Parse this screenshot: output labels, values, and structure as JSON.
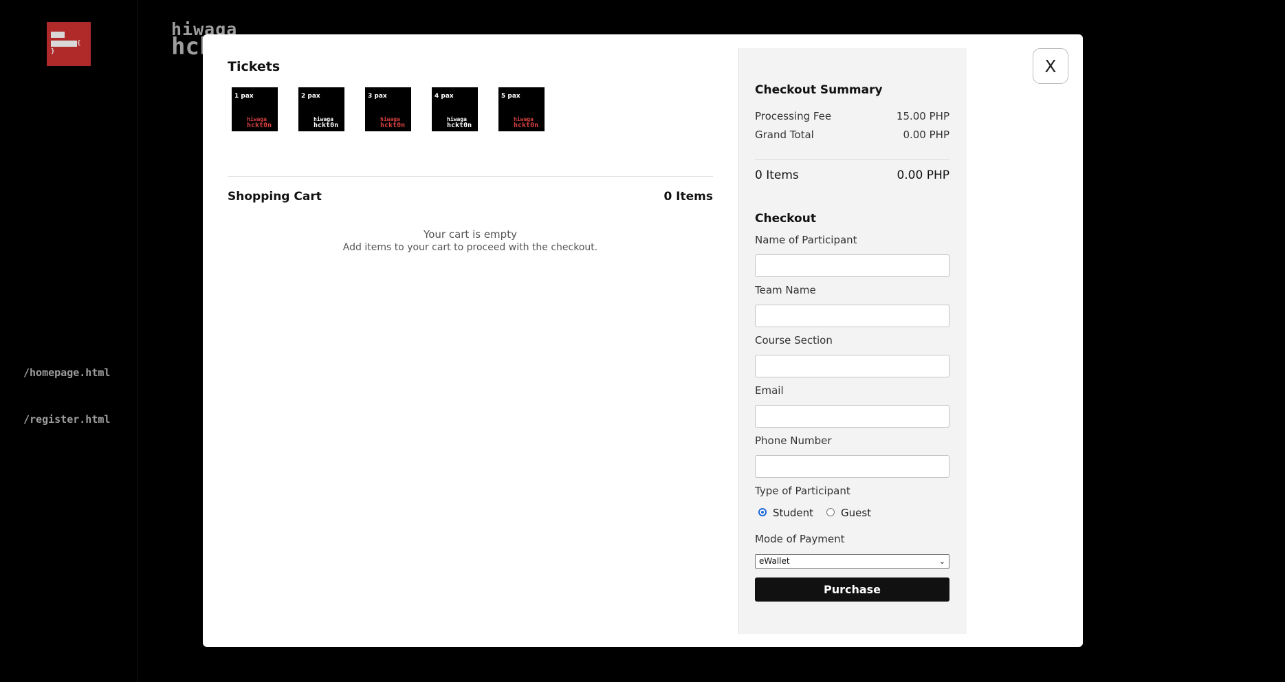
{
  "background": {
    "logo_icon": "bracket-logo-icon",
    "logo_brace_1": "{",
    "logo_brace_2": "}",
    "brand_top": "hiwaga",
    "brand_bottom": "hck",
    "nav_home": "/homepage.html",
    "nav_register": "/register.html"
  },
  "modal": {
    "close_label": "X",
    "tickets_title": "Tickets",
    "tickets": [
      {
        "pax": "1 pax",
        "top": "hiwaga",
        "bottom": "hckt0n",
        "accent": "#d94040"
      },
      {
        "pax": "2 pax",
        "top": "hiwaga",
        "bottom": "hckt0n",
        "accent": "#ffffff"
      },
      {
        "pax": "3 pax",
        "top": "hiwaga",
        "bottom": "hckt0n",
        "accent": "#d94040"
      },
      {
        "pax": "4 pax",
        "top": "hiwaga",
        "bottom": "hckt0n",
        "accent": "#ffffff"
      },
      {
        "pax": "5 pax",
        "top": "hiwaga",
        "bottom": "hckt0n",
        "accent": "#d94040"
      }
    ],
    "cart": {
      "title": "Shopping Cart",
      "count": "0 Items",
      "empty_title": "Your cart is empty",
      "empty_sub": "Add items to your cart to proceed with the checkout."
    },
    "summary": {
      "title": "Checkout Summary",
      "fee_label": "Processing Fee",
      "fee_value": "15.00 PHP",
      "total_label": "Grand Total",
      "total_value": "0.00 PHP",
      "items_label": "0 Items",
      "items_value": "0.00 PHP"
    },
    "checkout": {
      "title": "Checkout",
      "name_label": "Name of Participant",
      "name_value": "",
      "team_label": "Team Name",
      "team_value": "",
      "course_label": "Course Section",
      "course_value": "",
      "email_label": "Email",
      "email_value": "",
      "phone_label": "Phone Number",
      "phone_value": "",
      "type_label": "Type of Participant",
      "type_options": [
        "Student",
        "Guest"
      ],
      "type_selected": "Student",
      "payment_label": "Mode of Payment",
      "payment_selected": "eWallet",
      "purchase_label": "Purchase"
    }
  }
}
